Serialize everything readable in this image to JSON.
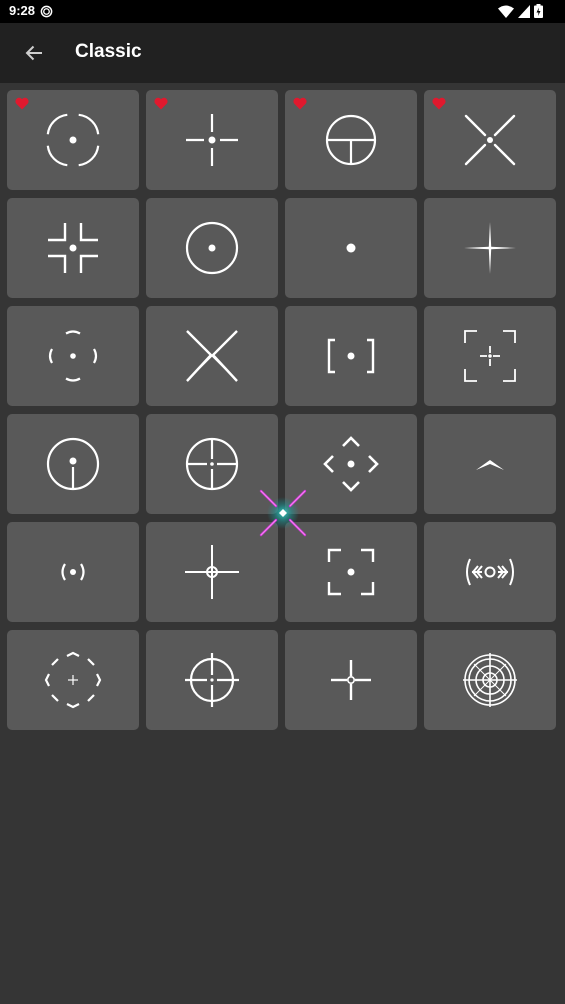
{
  "status_bar": {
    "time": "9:28",
    "left_icon": "sync-icon",
    "right_icons": [
      "wifi-icon",
      "signal-icon",
      "battery-icon"
    ]
  },
  "app_bar": {
    "title": "Classic",
    "back_icon": "arrow-back-icon"
  },
  "colors": {
    "background": "#353535",
    "app_bar": "#212121",
    "tile": "#595959",
    "favorite": "#e0192e",
    "crosshair": "#ffffff"
  },
  "crosshairs": [
    {
      "icon": "crosshair-ring-dot-icon",
      "favorite": true
    },
    {
      "icon": "crosshair-gap-cross-dot-icon",
      "favorite": true
    },
    {
      "icon": "crosshair-circle-t-icon",
      "favorite": true
    },
    {
      "icon": "crosshair-x-dot-icon",
      "favorite": true
    },
    {
      "icon": "crosshair-corner-brackets-dot-icon",
      "favorite": false
    },
    {
      "icon": "crosshair-circle-dot-icon",
      "favorite": false
    },
    {
      "icon": "crosshair-dot-icon",
      "favorite": false
    },
    {
      "icon": "crosshair-thin-star-icon",
      "favorite": false
    },
    {
      "icon": "crosshair-brace-ring-dot-icon",
      "favorite": false
    },
    {
      "icon": "crosshair-x-gap-icon",
      "favorite": false
    },
    {
      "icon": "crosshair-square-brackets-dot-icon",
      "favorite": false
    },
    {
      "icon": "crosshair-corners-cross-icon",
      "favorite": false
    },
    {
      "icon": "crosshair-circle-dot-stem-icon",
      "favorite": false
    },
    {
      "icon": "crosshair-circle-cross-icon",
      "favorite": false
    },
    {
      "icon": "crosshair-diamond-chevrons-icon",
      "favorite": false
    },
    {
      "icon": "crosshair-chevron-up-icon",
      "favorite": false
    },
    {
      "icon": "crosshair-parens-dot-icon",
      "favorite": false
    },
    {
      "icon": "crosshair-cross-small-circle-icon",
      "favorite": false
    },
    {
      "icon": "crosshair-frame-corners-dot-icon",
      "favorite": false
    },
    {
      "icon": "crosshair-arrows-ring-icon",
      "favorite": false
    },
    {
      "icon": "crosshair-octagon-plus-icon",
      "favorite": false
    },
    {
      "icon": "crosshair-scope-ring-icon",
      "favorite": false
    },
    {
      "icon": "crosshair-cross-ring-center-icon",
      "favorite": false
    },
    {
      "icon": "crosshair-target-rings-icon",
      "favorite": false
    }
  ],
  "floating_button": {
    "icon": "crosshair-overlay-icon"
  }
}
